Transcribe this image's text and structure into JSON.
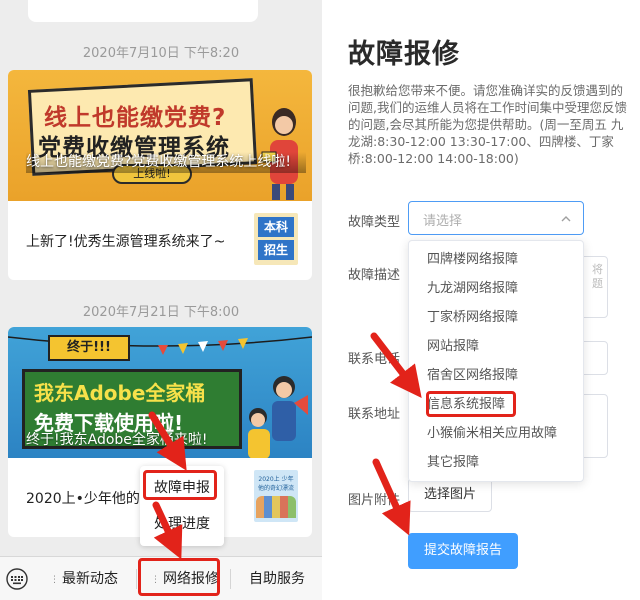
{
  "feed": {
    "timestamp_1": "2020年7月10日 下午8:20",
    "timestamp_2": "2020年7月21日 下午8:00",
    "article_1": {
      "banner_line_1": "线上也能缴党费?",
      "banner_line_2": "党费收缴管理系统",
      "banner_pill": "上线啦!",
      "title": "线上也能缴党费?党费收缴管理系统上线啦!",
      "sub_title": "上新了!优秀生源管理系统来了~",
      "thumb_line_1": "本科",
      "thumb_line_2": "招生"
    },
    "article_2": {
      "banner_sign": "终于!!!",
      "banner_line_1": "我东Adobe全家桶",
      "banner_line_2": "免费下载使用啦!",
      "title": "终于!我东Adobe全家桶来啦!",
      "sub_title": "2020上•少年他的",
      "thumb_caption": "2020上 少年他的奇幻漂流"
    }
  },
  "submenu": {
    "item_1": "故障申报",
    "item_2": "处理进度"
  },
  "menubar": {
    "item_1": "最新动态",
    "item_2": "网络报修",
    "item_3": "自助服务"
  },
  "form": {
    "title": "故障报修",
    "intro": "很抱歉给您带来不便。请您准确详实的反馈遇到的问题,我们的运维人员将在工作时间集中受理您反馈的问题,会尽其所能为您提供帮助。(周一至周五 九龙湖:8:30-12:00 13:30-17:00、四牌楼、丁家桥:8:00-12:00 14:00-18:00)",
    "label_type": "故障类型",
    "label_desc": "故障描述",
    "label_phone": "联系电话",
    "label_address": "联系地址",
    "label_attachment": "图片附件",
    "select_placeholder": "请选择",
    "desc_hint": "将\n题",
    "upload_label": "选择图片",
    "submit_label": "提交故障报告",
    "options": [
      "四牌楼网络报障",
      "九龙湖网络报障",
      "丁家桥网络报障",
      "网站报障",
      "宿舍区网络报障",
      "信息系统报障",
      "小猴偷米相关应用故障",
      "其它报障"
    ]
  },
  "colors": {
    "accent": "#409eff",
    "annotation": "#e2231a"
  }
}
